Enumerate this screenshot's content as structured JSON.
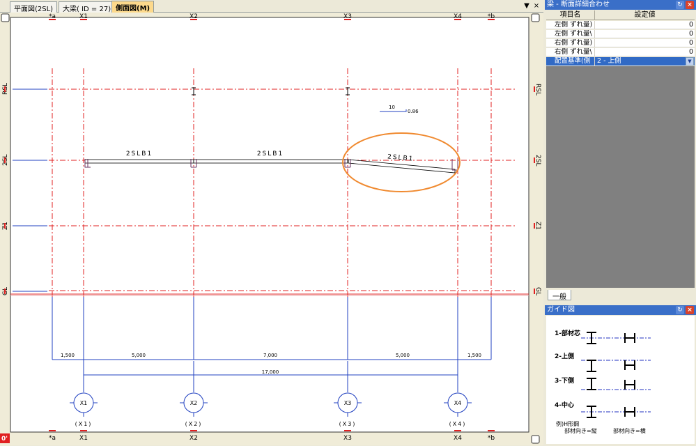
{
  "tabs": [
    {
      "label": "平面図(2SL)",
      "active": false
    },
    {
      "label": "大梁( ID = 27)",
      "active": false
    },
    {
      "label": "側面図(M)",
      "active": true
    }
  ],
  "tab_controls": {
    "dropdown": "▼",
    "close": "×"
  },
  "drawing": {
    "column_marks": [
      "*a",
      "X1",
      "X2",
      "X3",
      "X4",
      "*b"
    ],
    "floor_labels": [
      "RSL",
      "2SL",
      "Z1",
      "GL"
    ],
    "beam_labels": [
      "2SLB1",
      "2SLB1",
      "2SLB1"
    ],
    "slope_annotation": {
      "run": "10",
      "rise": "0.86"
    },
    "dims_top_row": [
      "1,500",
      "5,000",
      "7,000",
      "5,000",
      "1,500"
    ],
    "dim_total": "17,000",
    "circle_labels": [
      "X1",
      "X2",
      "X3",
      "X4"
    ],
    "circle_sub_labels": [
      "(X1)",
      "(X2)",
      "(X3)",
      "(X4)"
    ],
    "origin_mark": "0'"
  },
  "panel": {
    "title": "梁 - 断面詳細合わせ",
    "pin_icon": "↻",
    "close_icon": "×",
    "col_item": "項目名",
    "col_value": "設定値",
    "rows": [
      {
        "label": "左側 ずれ量)",
        "value": "0"
      },
      {
        "label": "左側 ずれ量\\",
        "value": "0"
      },
      {
        "label": "右側 ずれ量)",
        "value": "0"
      },
      {
        "label": "右側 ずれ量\\",
        "value": "0"
      }
    ],
    "selected_row": {
      "label": "配置基準(側",
      "value": "2 - 上側"
    },
    "sub_tab": "一般"
  },
  "guide": {
    "title": "ガイド図",
    "items": [
      "1-部材芯",
      "2-上側",
      "3-下側",
      "4-中心"
    ],
    "example_title": "例)H形鋼",
    "example_left": "部材向き=縦",
    "example_right": "部材向き=横"
  },
  "colors": {
    "grid_red": "#e02020",
    "dim_blue": "#2040c0",
    "highlight_orange": "#f08a30",
    "title_blue": "#3a6fc8"
  }
}
